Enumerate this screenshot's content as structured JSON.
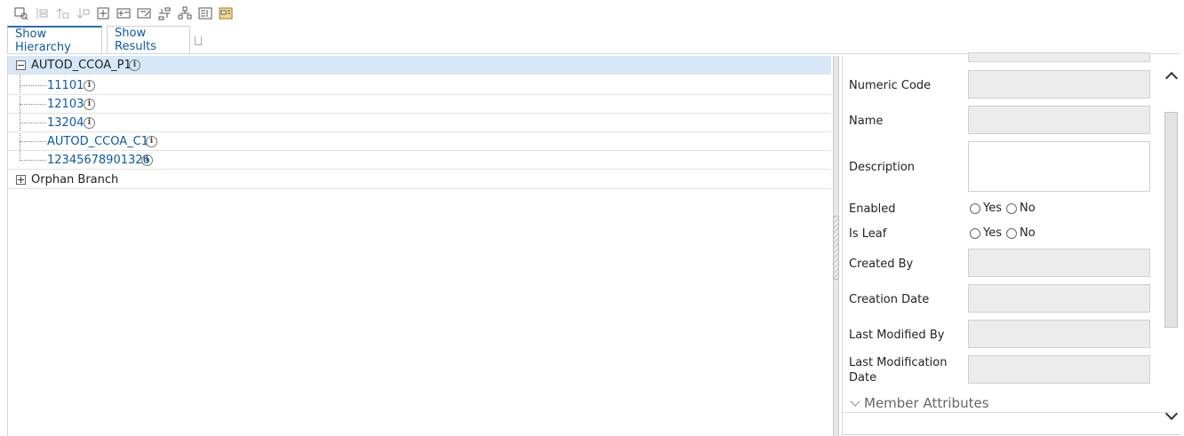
{
  "toolbar": {
    "icons": [
      "find-icon",
      "move-icon",
      "move-up-icon",
      "move-down-icon",
      "add-child-icon",
      "add-sibling-icon",
      "edit-node-icon",
      "reorder-icon",
      "hierarchy-icon",
      "properties-icon",
      "folder-view-icon"
    ]
  },
  "tabs": [
    {
      "label": "Show Hierarchy",
      "active": true
    },
    {
      "label": "Show Results",
      "active": false
    }
  ],
  "tree": {
    "root": {
      "label": "AUTOD_CCOA_P1",
      "expanded": true
    },
    "children": [
      {
        "label": "11101"
      },
      {
        "label": "12103"
      },
      {
        "label": "13204"
      },
      {
        "label": "AUTOD_CCOA_C1"
      },
      {
        "label": "12345678901326"
      }
    ],
    "orphan": {
      "label": "Orphan Branch",
      "expanded": false
    }
  },
  "details": {
    "numeric_code": {
      "label": "Numeric Code",
      "value": ""
    },
    "name": {
      "label": "Name",
      "value": ""
    },
    "description": {
      "label": "Description",
      "value": ""
    },
    "enabled": {
      "label": "Enabled",
      "yes": "Yes",
      "no": "No"
    },
    "is_leaf": {
      "label": "Is Leaf",
      "yes": "Yes",
      "no": "No"
    },
    "created_by": {
      "label": "Created By",
      "value": ""
    },
    "creation_date": {
      "label": "Creation Date",
      "value": ""
    },
    "last_modified_by": {
      "label": "Last Modified By",
      "value": ""
    },
    "last_modification_date": {
      "label": "Last Modification Date",
      "value": ""
    },
    "member_attributes": "Member Attributes"
  },
  "colors": {
    "link": "#0b5aa3",
    "selected_row": "#d6e8f8",
    "field_bg": "#ececec"
  }
}
